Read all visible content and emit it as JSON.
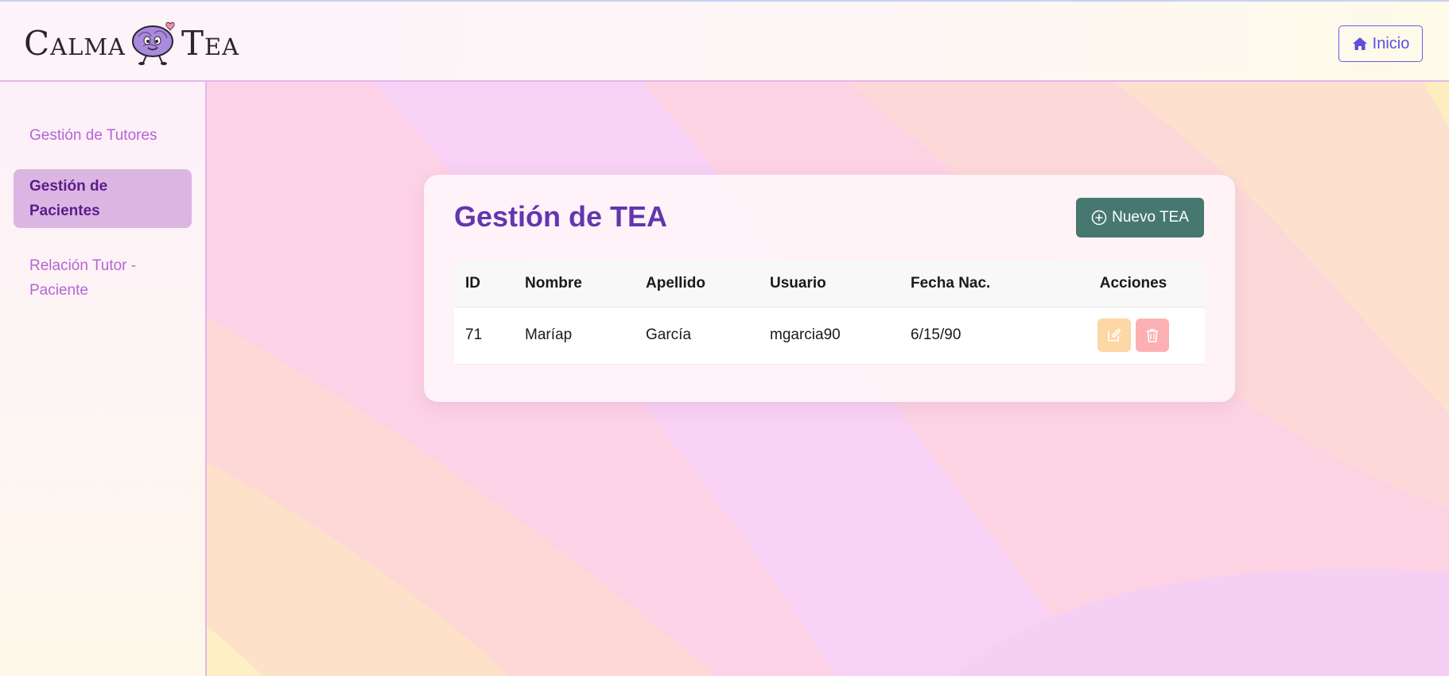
{
  "header": {
    "logo_left": "Calma",
    "logo_right": "Tea",
    "home_label": "Inicio"
  },
  "sidebar": {
    "items": [
      {
        "label": "Gestión de Tutores",
        "active": false
      },
      {
        "label": "Gestión de Pacientes",
        "active": true
      },
      {
        "label": "Relación Tutor - Paciente",
        "active": false
      }
    ]
  },
  "main": {
    "title": "Gestión de TEA",
    "new_button_label": "Nuevo TEA",
    "table": {
      "columns": [
        "ID",
        "Nombre",
        "Apellido",
        "Usuario",
        "Fecha Nac.",
        "Acciones"
      ],
      "rows": [
        [
          "71",
          "Maríap",
          "García",
          "mgarcia90",
          "6/15/90"
        ]
      ]
    }
  },
  "colors": {
    "accent_purple": "#6236b0",
    "sidebar_active_bg": "#dbb6e3",
    "new_button_bg": "#467870",
    "edit_button_bg": "#fdd7a4",
    "delete_button_bg": "#fbb1b2",
    "home_button_border": "#6a5ae6"
  },
  "icons": {
    "home": "home-icon",
    "mascot": "brain-mascot-icon",
    "new": "plus-circle-icon",
    "edit": "edit-icon",
    "delete": "trash-icon"
  }
}
